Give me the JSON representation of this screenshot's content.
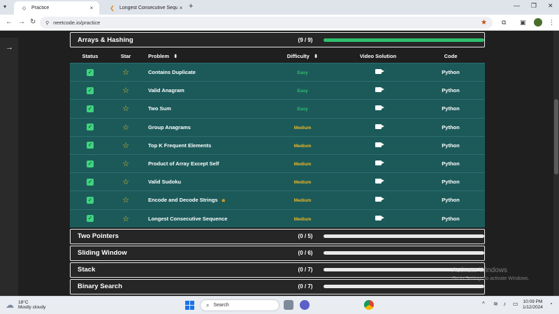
{
  "browser": {
    "tabs": [
      {
        "title": "Practice",
        "active": true
      },
      {
        "title": "Longest Consecutive Sequence",
        "active": false
      }
    ],
    "url": "neetcode.io/practice"
  },
  "columns": {
    "status": "Status",
    "star": "Star",
    "problem": "Problem",
    "problem_sort": "⬍",
    "difficulty": "Difficulty",
    "difficulty_sort": "⬍",
    "video": "Video Solution",
    "code": "Code"
  },
  "open_section": {
    "title": "Arrays & Hashing",
    "count": "(9 / 9)",
    "progress": 1.0,
    "rows": [
      {
        "problem": "Contains Duplicate",
        "difficulty": "Easy",
        "code": "Python",
        "locked": false
      },
      {
        "problem": "Valid Anagram",
        "difficulty": "Easy",
        "code": "Python",
        "locked": false
      },
      {
        "problem": "Two Sum",
        "difficulty": "Easy",
        "code": "Python",
        "locked": false
      },
      {
        "problem": "Group Anagrams",
        "difficulty": "Medium",
        "code": "Python",
        "locked": false
      },
      {
        "problem": "Top K Frequent Elements",
        "difficulty": "Medium",
        "code": "Python",
        "locked": false
      },
      {
        "problem": "Product of Array Except Self",
        "difficulty": "Medium",
        "code": "Python",
        "locked": false
      },
      {
        "problem": "Valid Sudoku",
        "difficulty": "Medium",
        "code": "Python",
        "locked": false
      },
      {
        "problem": "Encode and Decode Strings",
        "difficulty": "Medium",
        "code": "Python",
        "locked": true
      },
      {
        "problem": "Longest Consecutive Sequence",
        "difficulty": "Medium",
        "code": "Python",
        "locked": false
      }
    ]
  },
  "collapsed_sections": [
    {
      "title": "Two Pointers",
      "count": "(0 / 5)",
      "progress": 0
    },
    {
      "title": "Sliding Window",
      "count": "(0 / 6)",
      "progress": 0
    },
    {
      "title": "Stack",
      "count": "(0 / 7)",
      "progress": 0
    },
    {
      "title": "Binary Search",
      "count": "(0 / 7)",
      "progress": 0
    }
  ],
  "watermark": {
    "line1": "Activate Windows",
    "line2": "Go to Settings to activate Windows."
  },
  "taskbar": {
    "temp": "18°C",
    "weather": "Mostly cloudy",
    "search": "Search",
    "time": "10:09 PM",
    "date": "1/12/2024"
  },
  "colors": {
    "row_bg": "#1c5a5a",
    "easy": "#2fbf6f",
    "medium": "#f2b924",
    "progress_fill": "#2fbf6f"
  },
  "icons": {
    "check": "check-icon",
    "star": "star-outline-icon",
    "video": "video-camera-icon",
    "lock": "lock-icon"
  }
}
